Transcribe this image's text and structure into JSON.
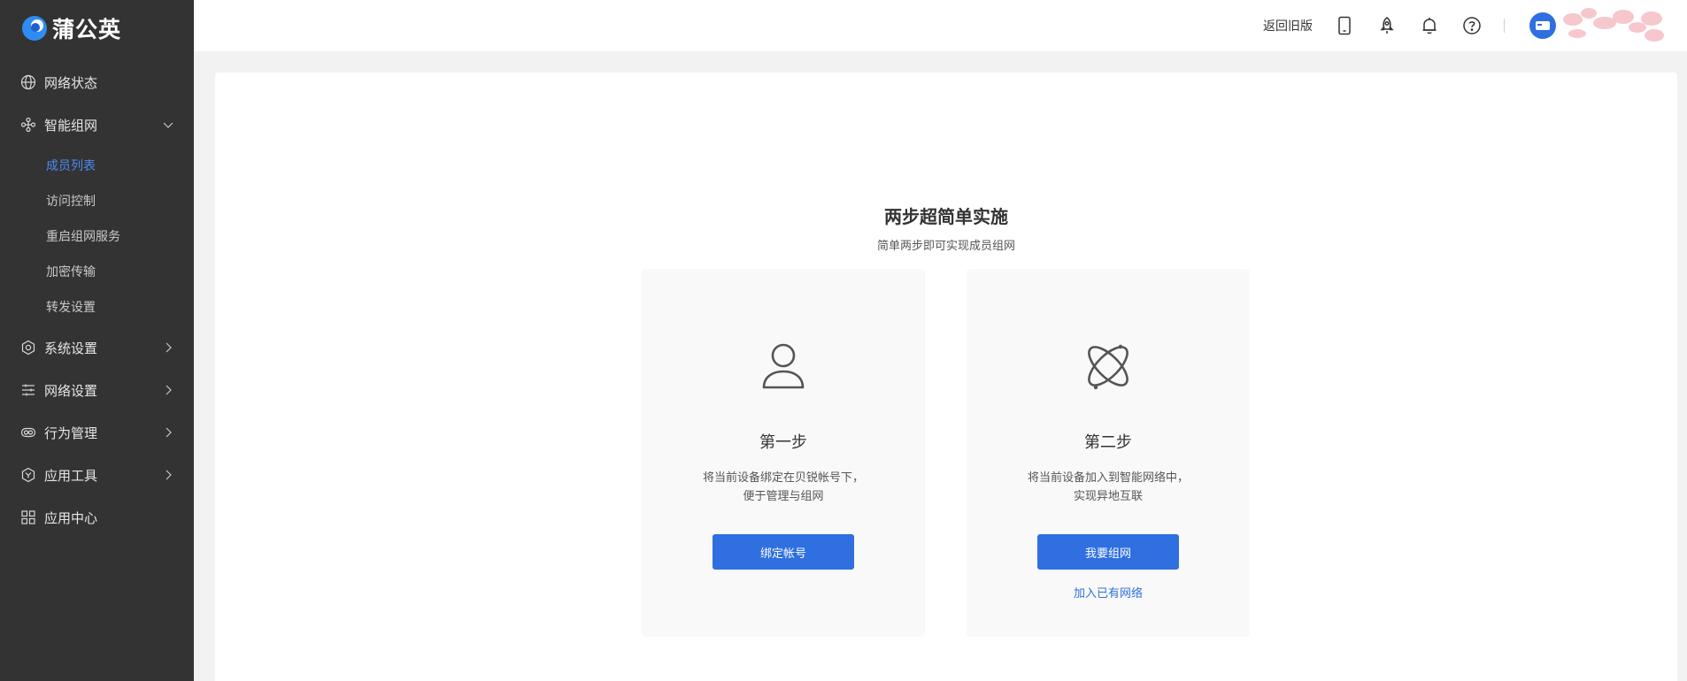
{
  "brand": {
    "name": "蒲公英"
  },
  "sidebar": {
    "items": [
      {
        "label": "网络状态",
        "icon": "globe-icon"
      },
      {
        "label": "智能组网",
        "icon": "network-icon",
        "expanded": true,
        "children": [
          {
            "label": "成员列表",
            "active": true
          },
          {
            "label": "访问控制"
          },
          {
            "label": "重启组网服务"
          },
          {
            "label": "加密传输"
          },
          {
            "label": "转发设置"
          }
        ]
      },
      {
        "label": "系统设置",
        "icon": "gear-icon"
      },
      {
        "label": "网络设置",
        "icon": "sliders-icon"
      },
      {
        "label": "行为管理",
        "icon": "link-icon"
      },
      {
        "label": "应用工具",
        "icon": "toolbox-icon"
      },
      {
        "label": "应用中心",
        "icon": "grid-icon"
      }
    ]
  },
  "header": {
    "old_version_label": "返回旧版",
    "icons": [
      "mobile-icon",
      "rocket-icon",
      "bell-icon",
      "help-icon"
    ]
  },
  "main": {
    "title": "两步超简单实施",
    "subtitle": "简单两步即可实现成员组网",
    "steps": [
      {
        "icon": "user-icon",
        "title": "第一步",
        "desc_line1": "将当前设备绑定在贝锐帐号下，",
        "desc_line2": "便于管理与组网",
        "button": "绑定帐号"
      },
      {
        "icon": "atom-icon",
        "title": "第二步",
        "desc_line1": "将当前设备加入到智能网络中，",
        "desc_line2": "实现异地互联",
        "button": "我要组网",
        "link": "加入已有网络"
      }
    ]
  },
  "colors": {
    "accent": "#2f6fe0",
    "sidebar_bg": "#333333",
    "active_text": "#4b8bf5"
  }
}
